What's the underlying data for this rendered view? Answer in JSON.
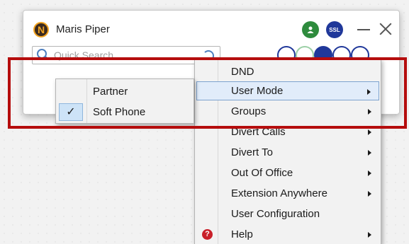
{
  "header": {
    "user_name": "Maris Piper",
    "ssl_label": "SSL"
  },
  "search": {
    "placeholder": "Quick Search"
  },
  "main_menu": {
    "items": [
      {
        "label": "DND"
      },
      {
        "label": "User Mode"
      },
      {
        "label": "Groups"
      },
      {
        "label": "Divert Calls"
      },
      {
        "label": "Divert To"
      },
      {
        "label": "Out Of Office"
      },
      {
        "label": "Extension Anywhere"
      },
      {
        "label": "User Configuration"
      },
      {
        "label": "Help"
      }
    ]
  },
  "user_mode_submenu": {
    "items": [
      {
        "label": "Partner",
        "checked": false
      },
      {
        "label": "Soft Phone",
        "checked": true
      }
    ],
    "check_mark": "✓"
  },
  "colors": {
    "annotation_frame": "#b50d0d",
    "status_green": "#2e8b3d",
    "ssl_blue": "#20389a",
    "help_red": "#c9202a"
  }
}
